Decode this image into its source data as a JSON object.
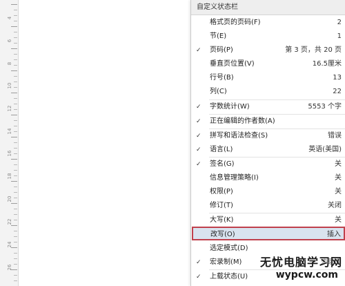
{
  "ruler": {
    "numbers": [
      "4",
      "6",
      "8",
      "10",
      "12",
      "14",
      "16",
      "18",
      "20",
      "22",
      "24",
      "26"
    ]
  },
  "menu": {
    "title": "自定义状态栏",
    "items": [
      {
        "label": "格式页的页码(F)",
        "value": "2",
        "checked": false
      },
      {
        "label": "节(E)",
        "value": "1",
        "checked": false
      },
      {
        "label": "页码(P)",
        "value": "第 3 页，共 20 页",
        "checked": true
      },
      {
        "label": "垂直页位置(V)",
        "value": "16.5厘米",
        "checked": false
      },
      {
        "label": "行号(B)",
        "value": "13",
        "checked": false
      },
      {
        "label": "列(C)",
        "value": "22",
        "checked": false
      },
      {
        "label": "字数统计(W)",
        "value": "5553 个字",
        "checked": true
      },
      {
        "label": "正在编辑的作者数(A)",
        "value": "",
        "checked": true
      },
      {
        "label": "拼写和语法检查(S)",
        "value": "错误",
        "checked": true
      },
      {
        "label": "语言(L)",
        "value": "英语(美国)",
        "checked": true
      },
      {
        "label": "签名(G)",
        "value": "关",
        "checked": true
      },
      {
        "label": "信息管理策略(I)",
        "value": "关",
        "checked": false
      },
      {
        "label": "权限(P)",
        "value": "关",
        "checked": false
      },
      {
        "label": "修订(T)",
        "value": "关闭",
        "checked": false
      },
      {
        "label": "大写(K)",
        "value": "关",
        "checked": false
      },
      {
        "label": "改写(O)",
        "value": "插入",
        "checked": false
      },
      {
        "label": "选定模式(D)",
        "value": "",
        "checked": false
      },
      {
        "label": "宏录制(M)",
        "value": "未录制",
        "checked": true
      },
      {
        "label": "上载状态(U)",
        "value": "",
        "checked": true
      }
    ]
  },
  "check_glyph": "✓",
  "watermark": {
    "cn": "无忧电脑学习网",
    "en": "wypcw.com"
  },
  "colors": {
    "highlight_bg": "#d9e3ef",
    "highlight_border": "#c0404c",
    "title_bg": "#eeeeee"
  }
}
